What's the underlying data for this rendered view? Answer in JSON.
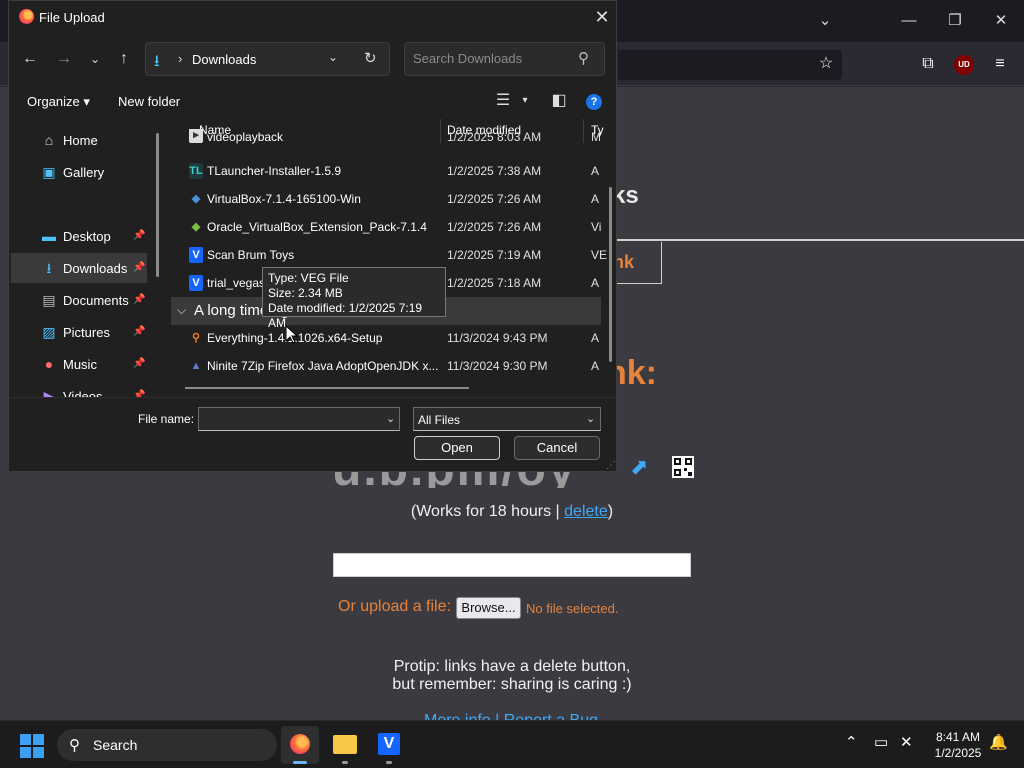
{
  "dialog": {
    "title": "File Upload",
    "address": {
      "location": "Downloads"
    },
    "search": {
      "placeholder": "Search Downloads"
    },
    "commands": {
      "organize": "Organize",
      "new_folder": "New folder"
    },
    "nav_items": [
      {
        "label": "Home",
        "icon": "home-icon",
        "pinned": false
      },
      {
        "label": "Gallery",
        "icon": "gallery-icon",
        "pinned": false
      },
      {
        "label": "Desktop",
        "icon": "desktop-icon",
        "pinned": true
      },
      {
        "label": "Downloads",
        "icon": "download-icon",
        "pinned": true,
        "selected": true
      },
      {
        "label": "Documents",
        "icon": "documents-icon",
        "pinned": true
      },
      {
        "label": "Pictures",
        "icon": "pictures-icon",
        "pinned": true
      },
      {
        "label": "Music",
        "icon": "music-icon",
        "pinned": true
      },
      {
        "label": "Videos",
        "icon": "videos-icon",
        "pinned": true
      }
    ],
    "columns": {
      "name": "Name",
      "date": "Date modified",
      "type": "Ty"
    },
    "files": [
      {
        "name": "videoplayback",
        "date": "1/2/2025 8:03 AM",
        "type": "M",
        "icon": "video-file-icon"
      },
      {
        "name": "TLauncher-Installer-1.5.9",
        "date": "1/2/2025 7:38 AM",
        "type": "A",
        "icon": "tlauncher-icon"
      },
      {
        "name": "VirtualBox-7.1.4-165100-Win",
        "date": "1/2/2025 7:26 AM",
        "type": "A",
        "icon": "virtualbox-icon"
      },
      {
        "name": "Oracle_VirtualBox_Extension_Pack-7.1.4",
        "date": "1/2/2025 7:26 AM",
        "type": "Vi",
        "icon": "extension-pack-icon"
      },
      {
        "name": "Scan Brum Toys",
        "date": "1/2/2025 7:19 AM",
        "type": "VE",
        "icon": "vegas-icon"
      },
      {
        "name": "trial_vegas",
        "date": "1/2/2025 7:18 AM",
        "type": "A",
        "icon": "vegas-icon"
      }
    ],
    "group_header": "A long time ago",
    "older_files": [
      {
        "name": "Everything-1.4.1.1026.x64-Setup",
        "date": "11/3/2024 9:43 PM",
        "type": "A",
        "icon": "everything-icon"
      },
      {
        "name": "Ninite 7Zip Firefox Java AdoptOpenJDK x...",
        "date": "11/3/2024 9:30 PM",
        "type": "A",
        "icon": "ninite-icon"
      }
    ],
    "tooltip": {
      "type": "Type: VEG File",
      "size": "Size: 2.34 MB",
      "modified": "Date modified: 1/2/2025 7:19 AM"
    },
    "file_name_label": "File name:",
    "file_name_value": "",
    "filter": "All Files",
    "open_label": "Open",
    "cancel_label": "Cancel"
  },
  "page": {
    "heading_fragment": "ks",
    "box_fragment": "nk",
    "link_fragment": "nk:",
    "short_link": "u.b.pm/oy",
    "works": "(Works for 18 hours | ",
    "delete": "delete",
    "works_end": ")",
    "upload_text": "Or upload a file:",
    "browse": "Browse...",
    "no_file": "No file selected.",
    "protip_1": "Protip: links have a delete button,",
    "protip_2": "but remember: sharing is caring :)",
    "footer": "More info | Report a Bug"
  },
  "taskbar": {
    "search_label": "Search",
    "time": "8:41 AM",
    "date": "1/2/2025",
    "apps": [
      "firefox-icon",
      "file-explorer-icon",
      "vegas-icon"
    ]
  },
  "colors": {
    "accent_orange": "#e8823a",
    "link_blue": "#3fa9f5",
    "win_blue": "#3aa0f3"
  }
}
